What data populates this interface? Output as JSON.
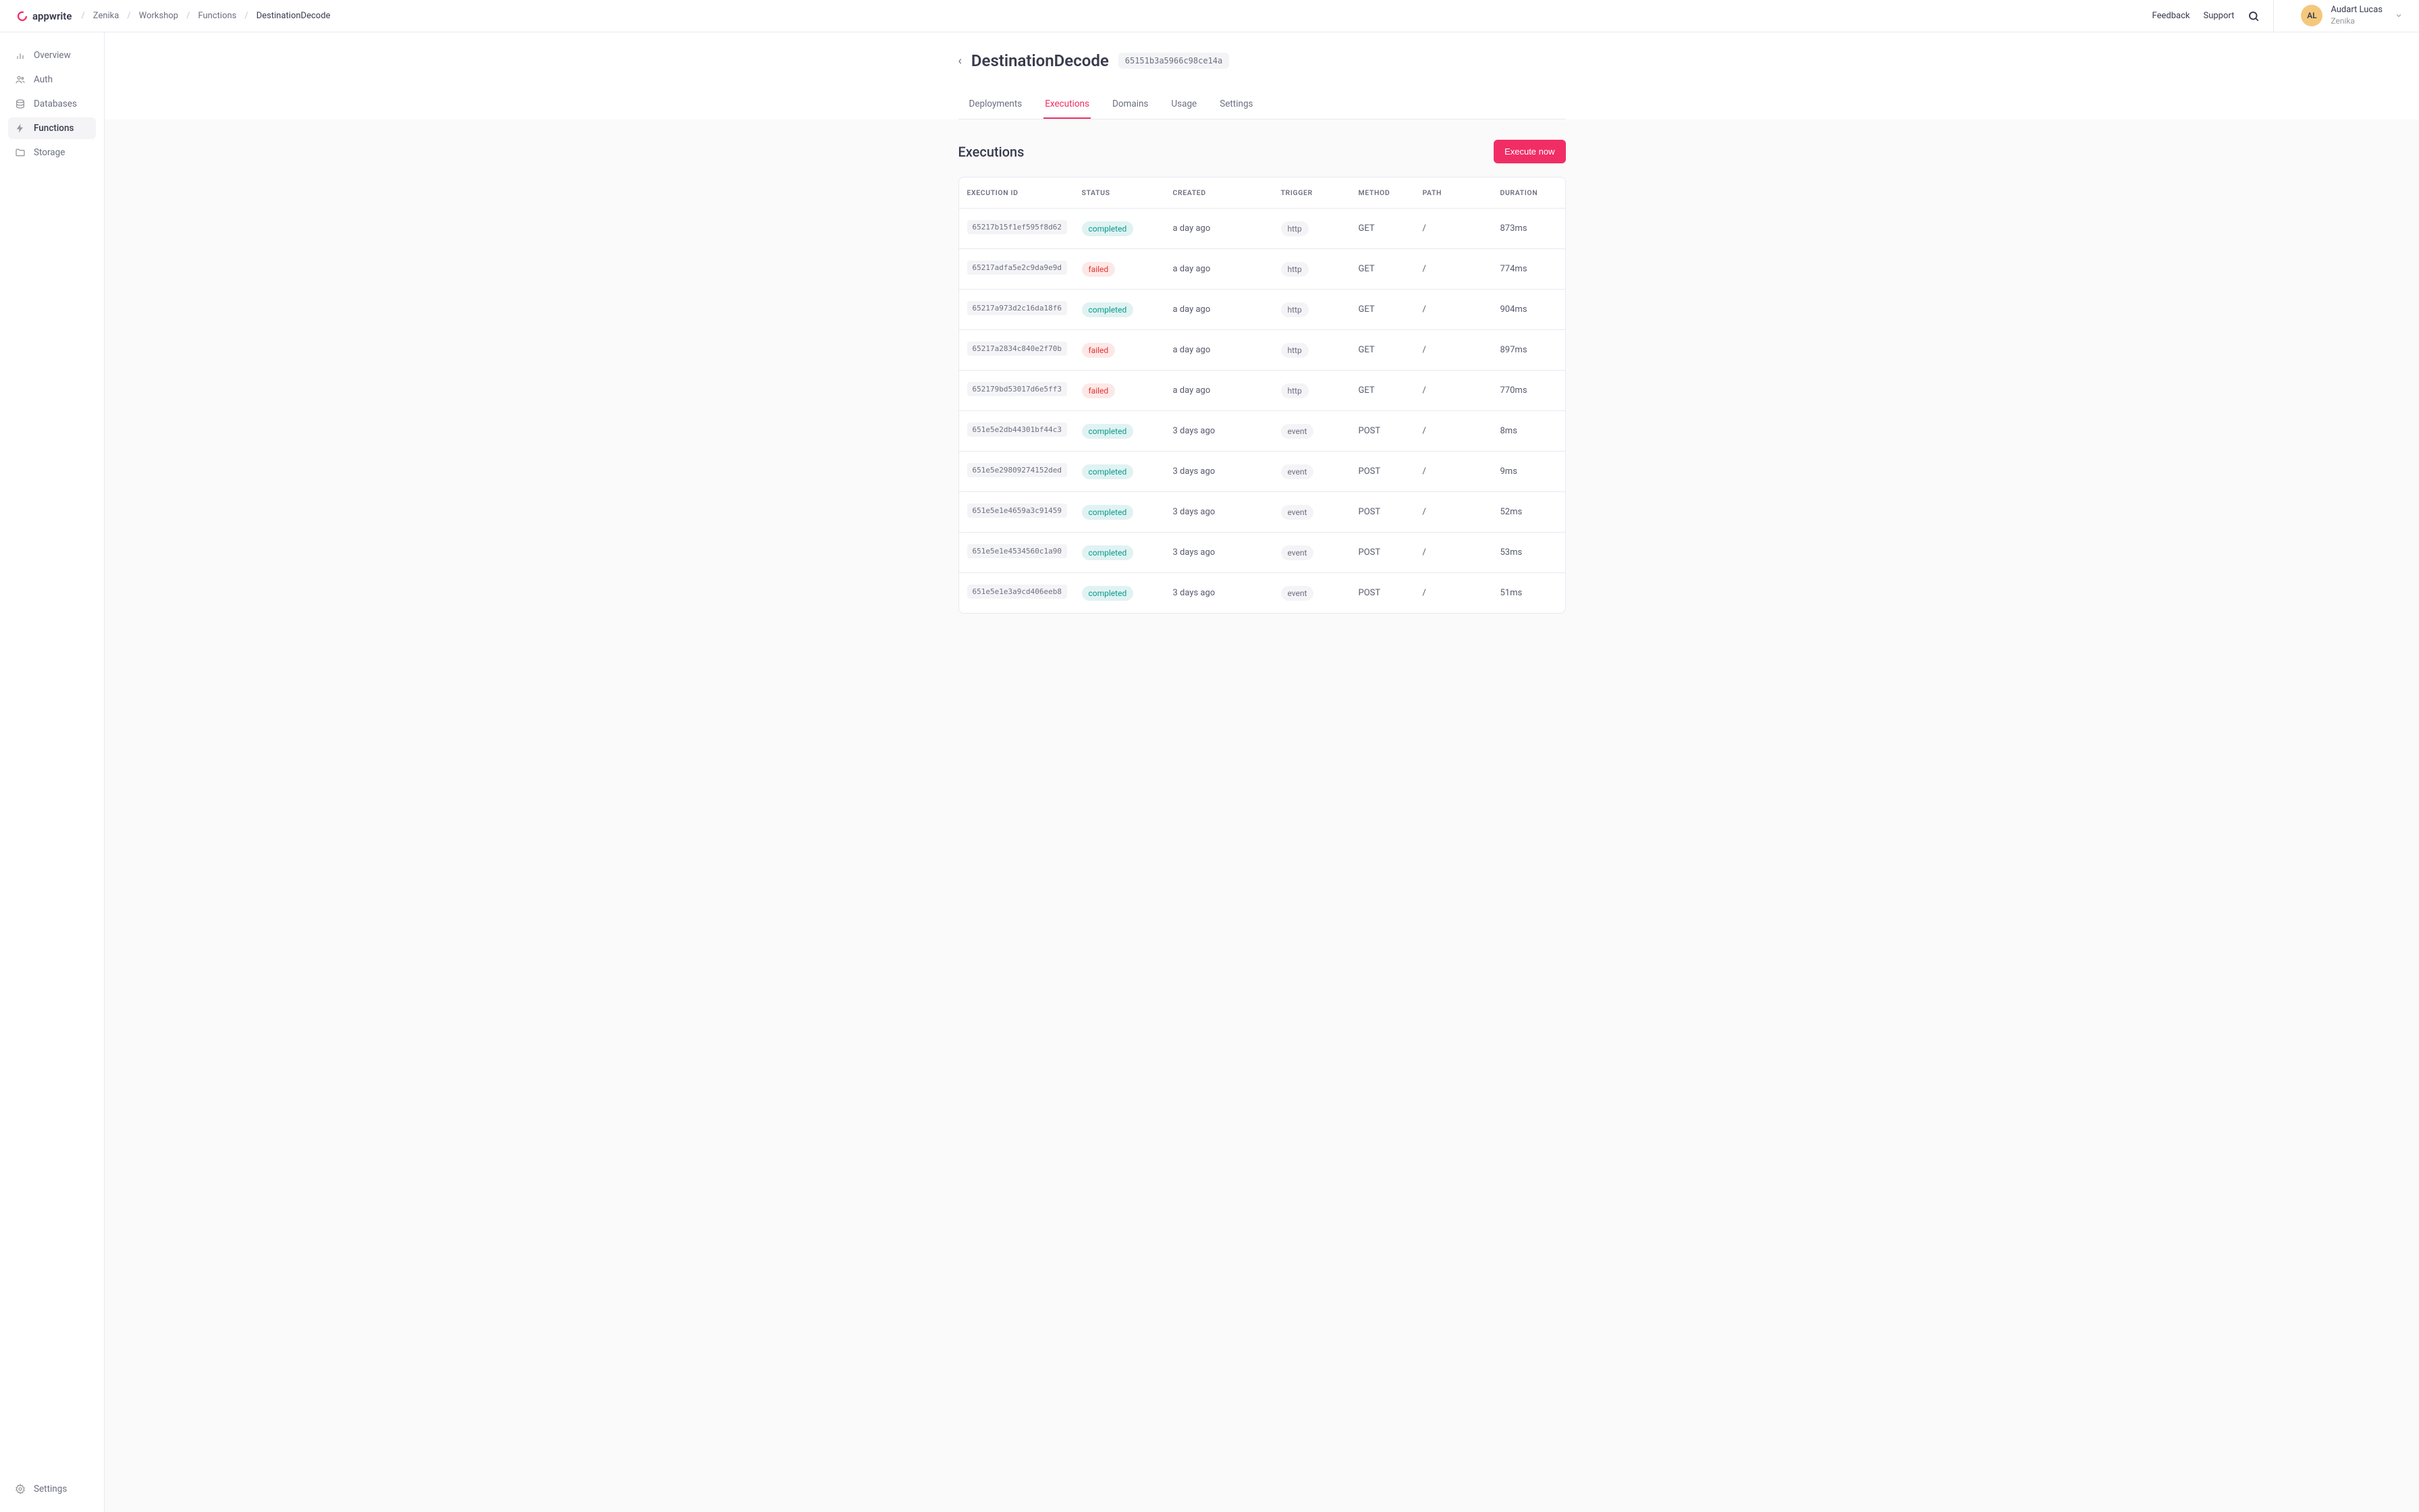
{
  "logo_text": "appwrite",
  "breadcrumb": [
    "Zenika",
    "Workshop",
    "Functions",
    "DestinationDecode"
  ],
  "header_links": {
    "feedback": "Feedback",
    "support": "Support"
  },
  "user": {
    "initials": "AL",
    "name": "Audart Lucas",
    "org": "Zenika"
  },
  "sidebar": {
    "items": [
      {
        "label": "Overview",
        "icon": "bar-chart"
      },
      {
        "label": "Auth",
        "icon": "users"
      },
      {
        "label": "Databases",
        "icon": "database"
      },
      {
        "label": "Functions",
        "icon": "lightning",
        "active": true
      },
      {
        "label": "Storage",
        "icon": "folder"
      }
    ],
    "bottom": {
      "label": "Settings",
      "icon": "gear"
    }
  },
  "page": {
    "title": "DestinationDecode",
    "function_id": "65151b3a5966c98ce14a"
  },
  "tabs": [
    "Deployments",
    "Executions",
    "Domains",
    "Usage",
    "Settings"
  ],
  "active_tab": 1,
  "section": {
    "title": "Executions",
    "button": "Execute now"
  },
  "table": {
    "columns": [
      "EXECUTION ID",
      "STATUS",
      "CREATED",
      "TRIGGER",
      "METHOD",
      "PATH",
      "DURATION"
    ],
    "rows": [
      {
        "id": "65217b15f1ef595f8d62",
        "status": "completed",
        "created": "a day ago",
        "trigger": "http",
        "method": "GET",
        "path": "/",
        "duration": "873ms"
      },
      {
        "id": "65217adfa5e2c9da9e9d",
        "status": "failed",
        "created": "a day ago",
        "trigger": "http",
        "method": "GET",
        "path": "/",
        "duration": "774ms"
      },
      {
        "id": "65217a973d2c16da18f6",
        "status": "completed",
        "created": "a day ago",
        "trigger": "http",
        "method": "GET",
        "path": "/",
        "duration": "904ms"
      },
      {
        "id": "65217a2834c840e2f70b",
        "status": "failed",
        "created": "a day ago",
        "trigger": "http",
        "method": "GET",
        "path": "/",
        "duration": "897ms"
      },
      {
        "id": "652179bd53017d6e5ff3",
        "status": "failed",
        "created": "a day ago",
        "trigger": "http",
        "method": "GET",
        "path": "/",
        "duration": "770ms"
      },
      {
        "id": "651e5e2db44301bf44c3",
        "status": "completed",
        "created": "3 days ago",
        "trigger": "event",
        "method": "POST",
        "path": "/",
        "duration": "8ms"
      },
      {
        "id": "651e5e29809274152ded",
        "status": "completed",
        "created": "3 days ago",
        "trigger": "event",
        "method": "POST",
        "path": "/",
        "duration": "9ms"
      },
      {
        "id": "651e5e1e4659a3c91459",
        "status": "completed",
        "created": "3 days ago",
        "trigger": "event",
        "method": "POST",
        "path": "/",
        "duration": "52ms"
      },
      {
        "id": "651e5e1e4534560c1a90",
        "status": "completed",
        "created": "3 days ago",
        "trigger": "event",
        "method": "POST",
        "path": "/",
        "duration": "53ms"
      },
      {
        "id": "651e5e1e3a9cd406eeb8",
        "status": "completed",
        "created": "3 days ago",
        "trigger": "event",
        "method": "POST",
        "path": "/",
        "duration": "51ms"
      }
    ]
  }
}
